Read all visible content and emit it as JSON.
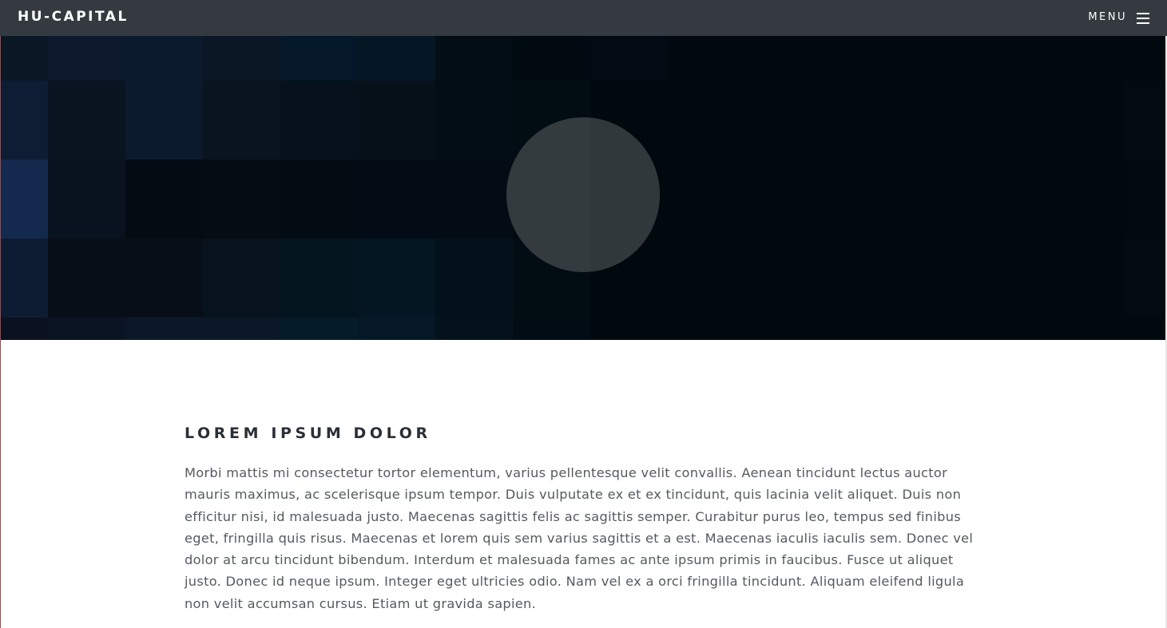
{
  "navbar": {
    "brand": "HU-CAPITAL",
    "menu_label": "MENU",
    "menu_icon": "hamburger-icon",
    "background": "#343a40"
  },
  "hero": {
    "background": "#01090f",
    "image": "pixelated-dark-blue-background",
    "circle_color": "#333b3f"
  },
  "section": {
    "title": "LOREM IPSUM DOLOR",
    "body": "Morbi mattis mi consectetur tortor elementum, varius pellentesque velit convallis. Aenean tincidunt lectus auctor mauris maximus, ac scelerisque ipsum tempor. Duis vulputate ex et ex tincidunt, quis lacinia velit aliquet. Duis non efficitur nisi, id malesuada justo. Maecenas sagittis felis ac sagittis semper. Curabitur purus leo, tempus sed finibus eget, fringilla quis risus. Maecenas et lorem quis sem varius sagittis et a est. Maecenas iaculis iaculis sem. Donec vel dolor at arcu tincidunt bibendum. Interdum et malesuada fames ac ante ipsum primis in faucibus. Fusce ut aliquet justo. Donec id neque ipsum. Integer eget ultricies odio. Nam vel ex a orci fringilla tincidunt. Aliquam eleifend ligula non velit accumsan cursus. Etiam ut gravida sapien."
  }
}
